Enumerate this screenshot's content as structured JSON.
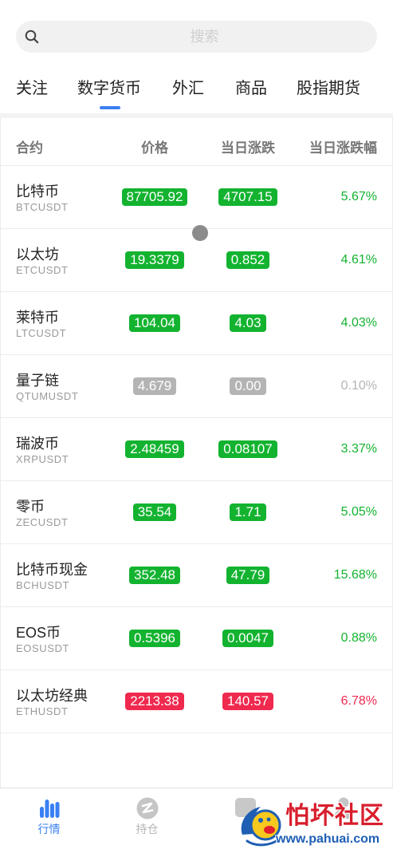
{
  "search": {
    "placeholder": "搜索",
    "icon": "search-icon"
  },
  "tabs": [
    {
      "label": "关注",
      "active": false
    },
    {
      "label": "数字货币",
      "active": true
    },
    {
      "label": "外汇",
      "active": false
    },
    {
      "label": "商品",
      "active": false
    },
    {
      "label": "股指期货",
      "active": false
    }
  ],
  "table": {
    "headers": {
      "contract": "合约",
      "price": "价格",
      "change": "当日涨跌",
      "change_pct": "当日涨跌幅"
    },
    "rows": [
      {
        "name": "比特币",
        "code": "BTCUSDT",
        "price": "87705.92",
        "change": "4707.15",
        "change_pct": "5.67%",
        "color": "green"
      },
      {
        "name": "以太坊",
        "code": "ETCUSDT",
        "price": "19.3379",
        "change": "0.852",
        "change_pct": "4.61%",
        "color": "green"
      },
      {
        "name": "莱特币",
        "code": "LTCUSDT",
        "price": "104.04",
        "change": "4.03",
        "change_pct": "4.03%",
        "color": "green"
      },
      {
        "name": "量子链",
        "code": "QTUMUSDT",
        "price": "4.679",
        "change": "0.00",
        "change_pct": "0.10%",
        "color": "gray"
      },
      {
        "name": "瑞波币",
        "code": "XRPUSDT",
        "price": "2.48459",
        "change": "0.08107",
        "change_pct": "3.37%",
        "color": "green"
      },
      {
        "name": "零币",
        "code": "ZECUSDT",
        "price": "35.54",
        "change": "1.71",
        "change_pct": "5.05%",
        "color": "green"
      },
      {
        "name": "比特币现金",
        "code": "BCHUSDT",
        "price": "352.48",
        "change": "47.79",
        "change_pct": "15.68%",
        "color": "green"
      },
      {
        "name": "EOS币",
        "code": "EOSUSDT",
        "price": "0.5396",
        "change": "0.0047",
        "change_pct": "0.88%",
        "color": "green"
      },
      {
        "name": "以太坊经典",
        "code": "ETHUSDT",
        "price": "2213.38",
        "change": "140.57",
        "change_pct": "6.78%",
        "color": "red"
      }
    ]
  },
  "bottom_nav": [
    {
      "label": "行情",
      "icon": "bar-chart-icon",
      "active": true
    },
    {
      "label": "持仓",
      "icon": "position-icon",
      "active": false
    },
    {
      "icon": "document-icon",
      "active": false
    },
    {
      "icon": "user-icon",
      "active": false
    }
  ],
  "colors": {
    "accent": "#3a80f3",
    "green": "#13b330",
    "red": "#f0294f",
    "gray": "#b4b4b4",
    "inactive": "#b5b5b5"
  },
  "watermark": {
    "title": "怕坏社区",
    "url": "www.pahuai.com"
  }
}
